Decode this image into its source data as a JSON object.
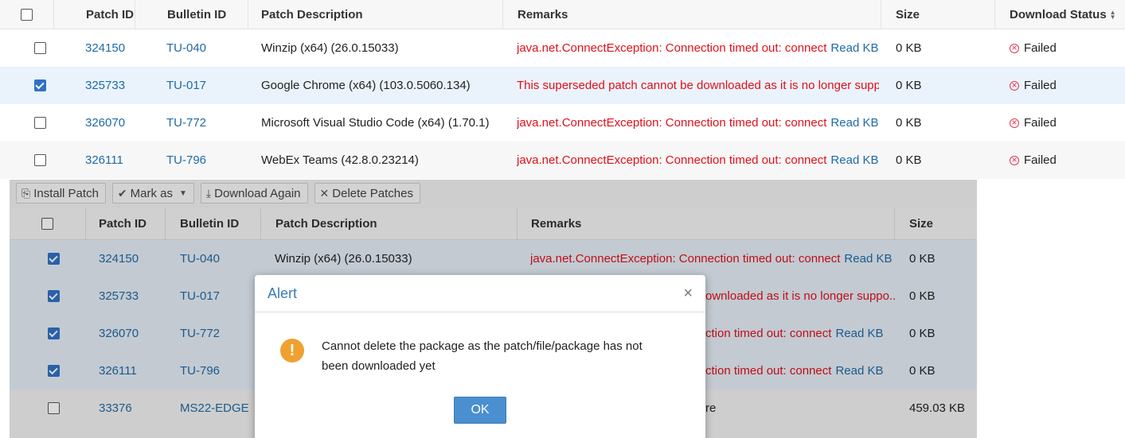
{
  "top_table": {
    "columns": {
      "patch_id": "Patch ID",
      "bulletin_id": "Bulletin ID",
      "description": "Patch Description",
      "remarks": "Remarks",
      "size": "Size",
      "status": "Download Status"
    },
    "rows": [
      {
        "checked": false,
        "patch_id": "324150",
        "bulletin_id": "TU-040",
        "description": "Winzip (x64) (26.0.15033)",
        "remark": "java.net.ConnectException: Connection timed out: connect",
        "kb": "Read KB",
        "size": "0 KB",
        "status": "Failed"
      },
      {
        "checked": true,
        "patch_id": "325733",
        "bulletin_id": "TU-017",
        "description": "Google Chrome (x64) (103.0.5060.134)",
        "remark": "This superseded patch cannot be downloaded as it is no longer suppo...",
        "kb": "",
        "size": "0 KB",
        "status": "Failed"
      },
      {
        "checked": false,
        "patch_id": "326070",
        "bulletin_id": "TU-772",
        "description": "Microsoft Visual Studio Code (x64) (1.70.1)",
        "remark": "java.net.ConnectException: Connection timed out: connect",
        "kb": "Read KB",
        "size": "0 KB",
        "status": "Failed"
      },
      {
        "checked": false,
        "patch_id": "326111",
        "bulletin_id": "TU-796",
        "description": "WebEx Teams (42.8.0.23214)",
        "remark": "java.net.ConnectException: Connection timed out: connect",
        "kb": "Read KB",
        "size": "0 KB",
        "status": "Failed"
      }
    ]
  },
  "toolbar": {
    "install_patch": "Install Patch",
    "mark_as": "Mark as",
    "download_again": "Download Again",
    "delete_patches": "Delete Patches"
  },
  "lower_table": {
    "columns": {
      "patch_id": "Patch ID",
      "bulletin_id": "Bulletin ID",
      "description": "Patch Description",
      "remarks": "Remarks",
      "size": "Size"
    },
    "rows": [
      {
        "checked": true,
        "patch_id": "324150",
        "bulletin_id": "TU-040",
        "description": "Winzip (x64) (26.0.15033)",
        "remark": "java.net.ConnectException: Connection timed out: connect",
        "kb": "Read KB",
        "size": "0 KB"
      },
      {
        "checked": true,
        "patch_id": "325733",
        "bulletin_id": "TU-017",
        "description": "",
        "remark": "ownloaded as it is no longer suppo...",
        "kb": "",
        "size": "0 KB"
      },
      {
        "checked": true,
        "patch_id": "326070",
        "bulletin_id": "TU-772",
        "description": "",
        "remark": "ction timed out: connect",
        "kb": "Read KB",
        "size": "0 KB"
      },
      {
        "checked": true,
        "patch_id": "326111",
        "bulletin_id": "TU-796",
        "description": "",
        "remark": "ction timed out: connect",
        "kb": "Read KB",
        "size": "0 KB"
      },
      {
        "checked": false,
        "patch_id": "33376",
        "bulletin_id": "MS22-EDGE",
        "description": "",
        "remark": "re",
        "kb": "",
        "size": "459.03 KB"
      }
    ]
  },
  "modal": {
    "title": "Alert",
    "close_symbol": "×",
    "warning_symbol": "!",
    "message": "Cannot delete the package as the patch/file/package has not been downloaded yet",
    "ok_label": "OK"
  }
}
